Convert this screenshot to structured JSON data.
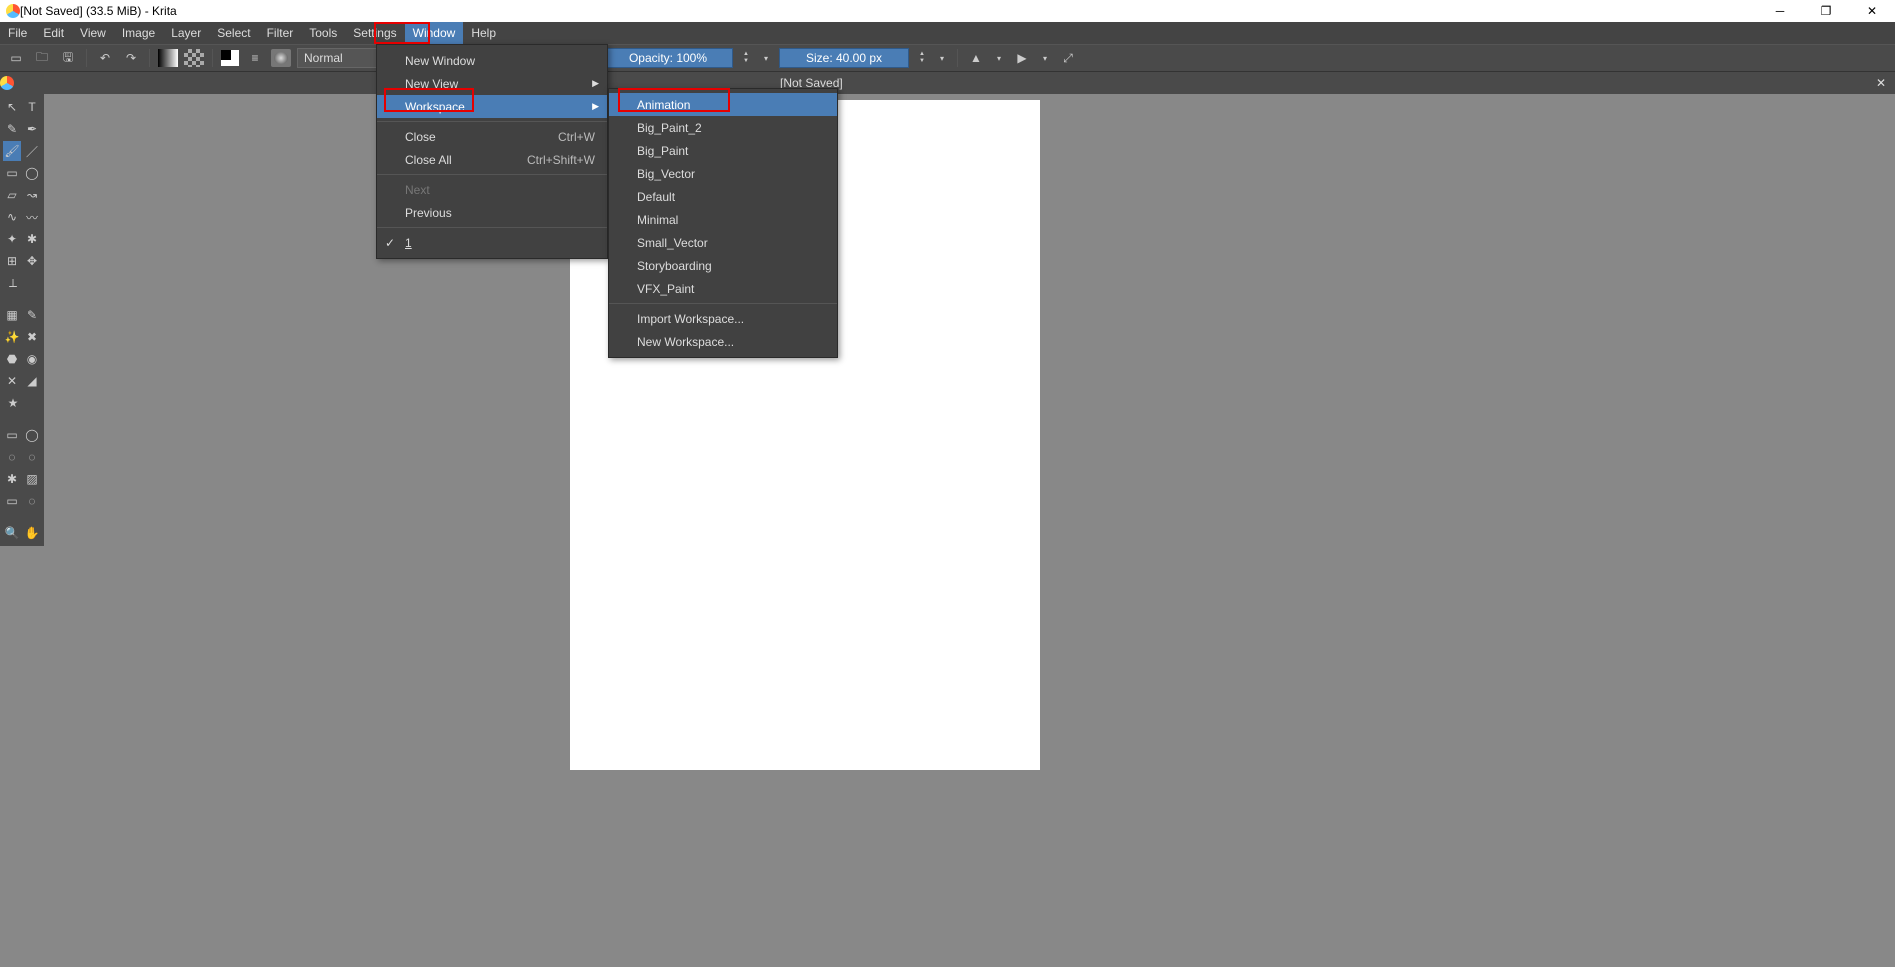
{
  "title": "[Not Saved]  (33.5 MiB)  - Krita",
  "menu": {
    "items": [
      "File",
      "Edit",
      "View",
      "Image",
      "Layer",
      "Select",
      "Filter",
      "Tools",
      "Settings",
      "Window",
      "Help"
    ]
  },
  "toolbar": {
    "blend_mode": "Normal",
    "opacity_label": "Opacity: 100%",
    "size_label": "Size: 40.00 px"
  },
  "doc_title": "[Not Saved]",
  "window_menu": {
    "new_window": "New Window",
    "new_view": "New View",
    "workspace": "Workspace",
    "close": "Close",
    "close_sc": "Ctrl+W",
    "close_all": "Close All",
    "close_all_sc": "Ctrl+Shift+W",
    "next": "Next",
    "previous": "Previous",
    "doc1": "1"
  },
  "workspace_menu": {
    "animation": "Animation",
    "big_paint_2": "Big_Paint_2",
    "big_paint": "Big_Paint",
    "big_vector": "Big_Vector",
    "default": "Default",
    "minimal": "Minimal",
    "small_vector": "Small_Vector",
    "storyboarding": "Storyboarding",
    "vfx_paint": "VFX_Paint",
    "import": "Import Workspace...",
    "new": "New Workspace..."
  }
}
